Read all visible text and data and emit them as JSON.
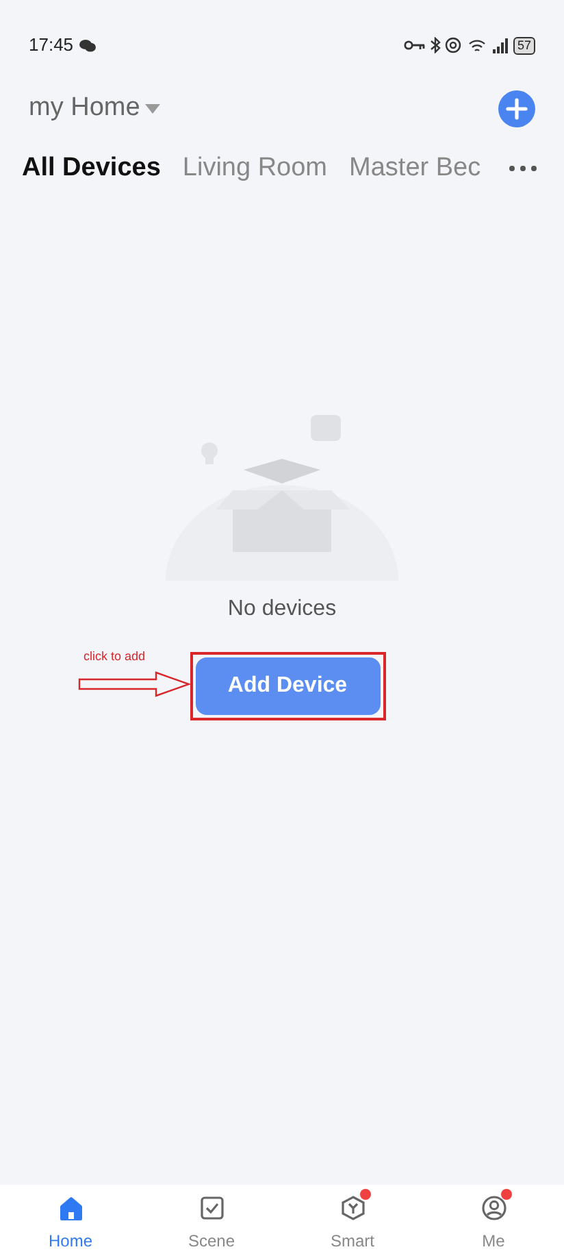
{
  "status_bar": {
    "time": "17:45",
    "battery": "57"
  },
  "header": {
    "home_name": "my Home"
  },
  "tabs": [
    {
      "label": "All Devices",
      "selected": true
    },
    {
      "label": "Living Room",
      "selected": false
    },
    {
      "label": "Master Bec",
      "selected": false
    }
  ],
  "empty_state": {
    "message": "No devices",
    "button": "Add Device"
  },
  "annotation": {
    "text": "click to add"
  },
  "bottom_nav": [
    {
      "label": "Home",
      "kind": "home",
      "selected": true,
      "badge": false
    },
    {
      "label": "Scene",
      "kind": "scene",
      "selected": false,
      "badge": false
    },
    {
      "label": "Smart",
      "kind": "smart",
      "selected": false,
      "badge": true
    },
    {
      "label": "Me",
      "kind": "me",
      "selected": false,
      "badge": true
    }
  ]
}
